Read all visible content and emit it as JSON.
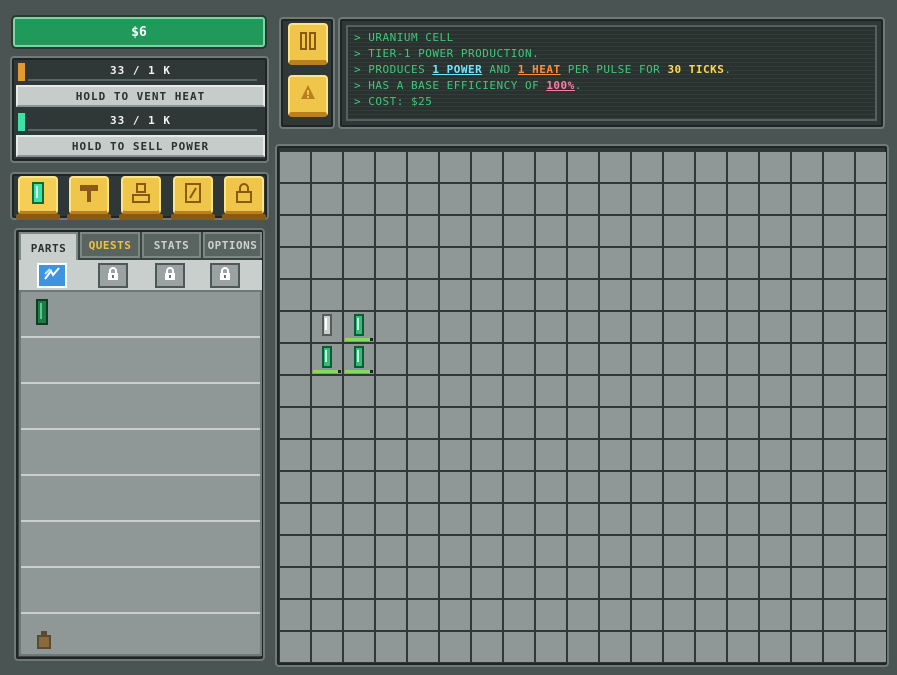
{
  "money": "$6",
  "heat": {
    "meter_text": "33 / 1 K",
    "fill_color": "#e39a2e",
    "button_label": "HOLD TO VENT HEAT"
  },
  "power": {
    "meter_text": "33 / 1 K",
    "fill_color": "#3fe0a8",
    "button_label": "HOLD TO SELL POWER"
  },
  "categories": [
    "cell-icon",
    "reflector-icon",
    "worker-icon",
    "plate-icon",
    "locked-icon"
  ],
  "tabs": [
    {
      "label": "PARTS",
      "active": true
    },
    {
      "label": "QUESTS",
      "active": false
    },
    {
      "label": "STATS",
      "active": false
    },
    {
      "label": "OPTIONS",
      "active": false
    }
  ],
  "subtabs": [
    "power-icon",
    "lock-icon",
    "lock-icon",
    "lock-icon"
  ],
  "controls": [
    "pause-icon",
    "alarm-bell-icon"
  ],
  "info": {
    "line1": "> URANIUM CELL",
    "line2": "> TIER-1 POWER PRODUCTION.",
    "line3_a": "> PRODUCES ",
    "line3_power": "1 POWER",
    "line3_b": " AND ",
    "line3_heat": "1 HEAT",
    "line3_c": " PER PULSE FOR ",
    "line3_ticks": "30 TICKS",
    "line3_d": ".",
    "line4_a": "> HAS A BASE EFFICIENCY OF ",
    "line4_eff": "100%",
    "line4_b": ".",
    "line5": "> COST: $25"
  },
  "grid": {
    "cols": 19,
    "rows": 16,
    "cells": [
      {
        "row": 5,
        "col": 1,
        "type": "depleted-cell",
        "life": 0
      },
      {
        "row": 5,
        "col": 2,
        "type": "uranium-cell",
        "life": 0.9
      },
      {
        "row": 6,
        "col": 1,
        "type": "uranium-cell",
        "life": 0.9
      },
      {
        "row": 6,
        "col": 2,
        "type": "uranium-cell",
        "life": 0.9
      }
    ]
  },
  "colors": {
    "accent": "#1f9a5a",
    "cell_green": "#2fbf73",
    "gold": "#f0c64a"
  }
}
